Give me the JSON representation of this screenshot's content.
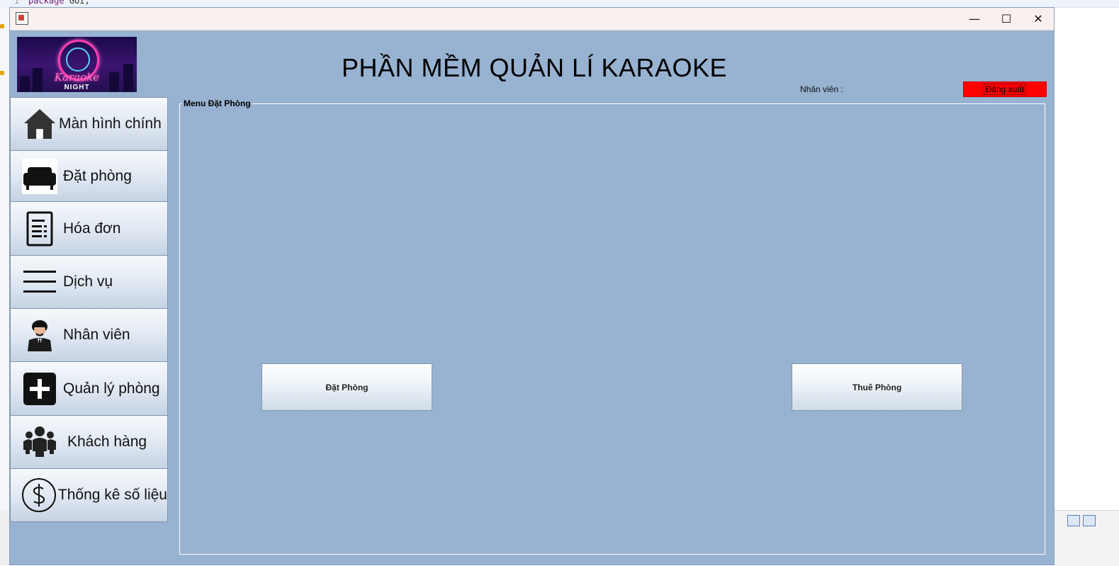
{
  "ide": {
    "line_number": "1",
    "code_keyword": "package",
    "code_rest": " GUI;"
  },
  "window": {
    "controls": {
      "minimize": "—",
      "maximize": "☐",
      "close": "✕"
    }
  },
  "header": {
    "logo_text_main": "Karaoke",
    "logo_text_sub": "NIGHT",
    "app_title": "PHẦN MỀM QUẢN LÍ KARAOKE",
    "staff_label": "Nhân viên :",
    "logout_label": "Đăng xuất"
  },
  "sidebar": {
    "items": [
      {
        "label": "Màn hình chính",
        "icon": "home-icon"
      },
      {
        "label": "Đặt phòng",
        "icon": "sofa-icon"
      },
      {
        "label": "Hóa đơn",
        "icon": "invoice-icon"
      },
      {
        "label": "Dịch vụ",
        "icon": "menu-lines-icon"
      },
      {
        "label": "Nhân viên",
        "icon": "staff-person-icon"
      },
      {
        "label": "Quản lý phòng",
        "icon": "plus-square-icon"
      },
      {
        "label": "Khách hàng",
        "icon": "group-people-icon"
      },
      {
        "label": "Thống kê số liệu",
        "icon": "dollar-circle-icon"
      }
    ]
  },
  "panel": {
    "title": "Menu Đặt Phòng",
    "book_button": "Đặt Phòng",
    "rent_button": "Thuê Phòng"
  },
  "colors": {
    "window_bg": "#98b2d1",
    "logout_bg": "#ff0000",
    "titlebar_bg": "#faf0ef"
  }
}
